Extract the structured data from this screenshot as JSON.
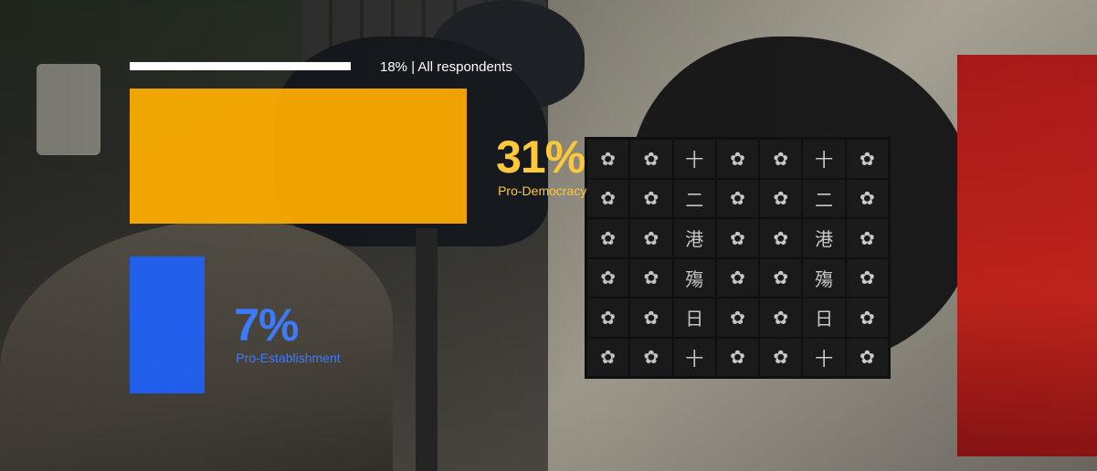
{
  "chart_data": {
    "type": "bar",
    "unit": "%",
    "overall": {
      "value": 18,
      "label": "18% | All respondents"
    },
    "categories": [
      "Pro-Democracy",
      "Pro-Establishment"
    ],
    "values": [
      31,
      7
    ],
    "value_labels": [
      "31%",
      "7%"
    ],
    "colors": [
      "#FFAE00",
      "#1E63FF"
    ],
    "label_colors": [
      "#FFC83A",
      "#3C7BFF"
    ],
    "title": "",
    "xlabel": "",
    "ylabel": "",
    "grid": false
  },
  "background": {
    "poster_glyphs": [
      "十",
      "二",
      "港",
      "殤",
      "日"
    ]
  }
}
